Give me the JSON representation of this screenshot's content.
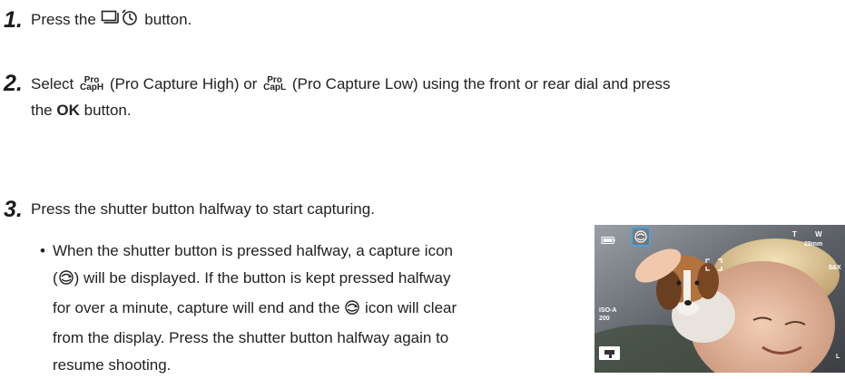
{
  "steps": [
    {
      "number": "1.",
      "parts": {
        "a": "Press the",
        "b": "button."
      }
    },
    {
      "number": "2.",
      "parts": {
        "a": "Select",
        "mode_high_top": "Pro",
        "mode_high_bottom": "CapH",
        "b": "(Pro Capture High) or",
        "mode_low_top": "Pro",
        "mode_low_bottom": "CapL",
        "c": "(Pro Capture Low) using the front or rear dial and press",
        "d": "the",
        "ok": "OK",
        "e": "button."
      }
    },
    {
      "number": "3.",
      "parts": {
        "a": "Press the shutter button halfway to start capturing."
      }
    }
  ],
  "bullet": {
    "dot": "•",
    "line1": "When the shutter button is pressed halfway, a capture icon",
    "line2a": "(",
    "line2b": ") will be displayed. If the button is kept pressed halfway",
    "line3a": "for over a minute, capture will end and the",
    "line3b": "icon will clear",
    "line4": "from the display. Press the shutter button halfway again to",
    "line5": "resume shooting."
  },
  "viewfinder": {
    "iso_label": "ISO-A",
    "iso_value": "200",
    "zoom_t": "T",
    "zoom_w": "W",
    "zoom_mm": "28mm",
    "right_labels": [
      "$&X",
      "L"
    ]
  },
  "colors": {
    "text": "#222222",
    "highlight": "#4aa3d8"
  },
  "icons": [
    "drive-self-timer-icon",
    "capture-icon",
    "battery-icon",
    "flash-icon"
  ]
}
